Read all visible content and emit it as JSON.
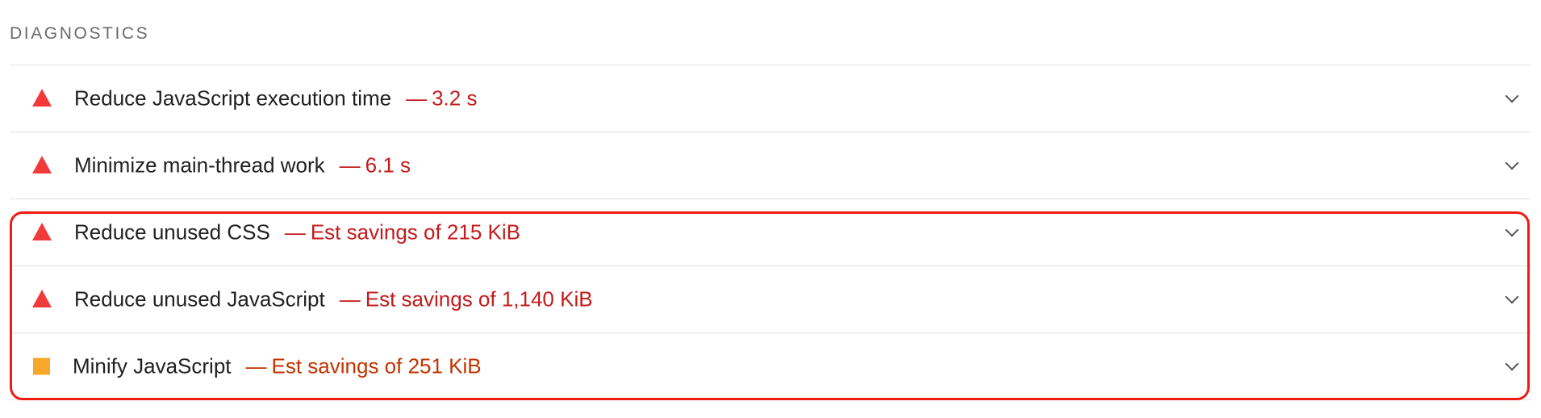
{
  "section": {
    "title": "DIAGNOSTICS"
  },
  "audits": [
    {
      "label": "Reduce JavaScript execution time",
      "detail": "3.2 s",
      "rating": "fail",
      "icon": "red-triangle-icon"
    },
    {
      "label": "Minimize main-thread work",
      "detail": "6.1 s",
      "rating": "fail",
      "icon": "red-triangle-icon"
    },
    {
      "label": "Reduce unused CSS",
      "detail": "Est savings of 215 KiB",
      "rating": "fail",
      "icon": "red-triangle-icon"
    },
    {
      "label": "Reduce unused JavaScript",
      "detail": "Est savings of 1,140 KiB",
      "rating": "fail",
      "icon": "red-triangle-icon"
    },
    {
      "label": "Minify JavaScript",
      "detail": "Est savings of 251 KiB",
      "rating": "average",
      "icon": "orange-square-icon"
    }
  ],
  "separator": "—",
  "colors": {
    "fail_icon": "#f33a3a",
    "fail_text": "#c41c1c",
    "average_icon": "#f7a82a",
    "average_text": "#c33300",
    "highlight_border": "#ee1c11"
  }
}
